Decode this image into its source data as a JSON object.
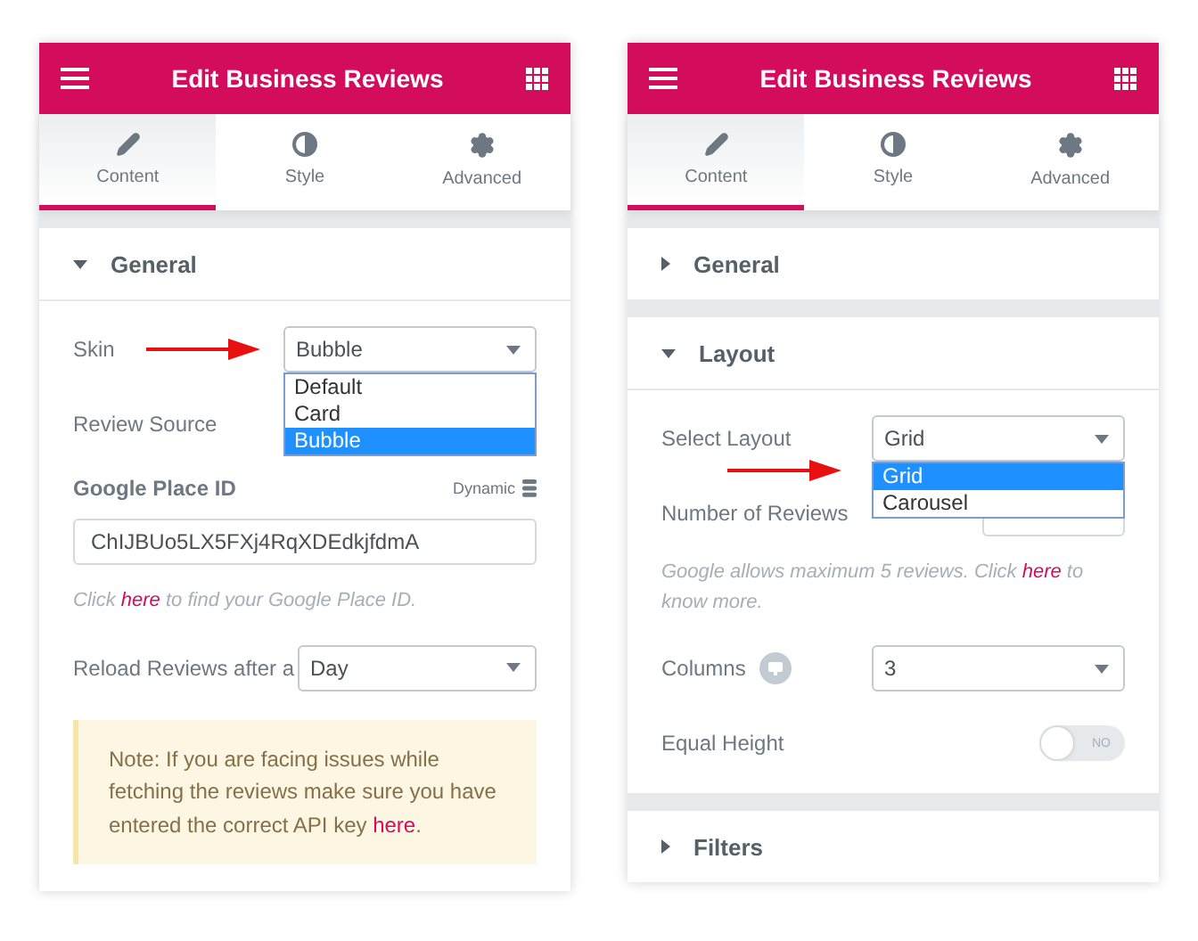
{
  "panels": [
    {
      "title": "Edit Business Reviews",
      "tabs": [
        {
          "label": "Content",
          "selected": true
        },
        {
          "label": "Style",
          "selected": false
        },
        {
          "label": "Advanced",
          "selected": false
        }
      ],
      "sections": [
        {
          "title": "General",
          "expanded": true,
          "controls": [
            {
              "kind": "select",
              "label": "Skin",
              "value": "Bubble",
              "open": true,
              "options": [
                {
                  "label": "Default",
                  "selected": false
                },
                {
                  "label": "Card",
                  "selected": false
                },
                {
                  "label": "Bubble",
                  "selected": true
                }
              ]
            },
            {
              "kind": "label",
              "label": "Review Source"
            },
            {
              "kind": "text",
              "label": "Google Place ID",
              "dynamic": "Dynamic",
              "value": "ChIJBUo5LX5FXj4RqXDEdkjfdmA"
            },
            {
              "kind": "hint",
              "before": "Click ",
              "link": "here",
              "after": " to find your Google Place ID."
            },
            {
              "kind": "select",
              "label": "Reload Reviews after a",
              "value": "Day",
              "open": false,
              "wide": true
            },
            {
              "kind": "note",
              "before": "Note: If you are facing issues while fetching the reviews make sure you have entered the correct API key ",
              "link": "here",
              "after": "."
            }
          ]
        }
      ]
    },
    {
      "title": "Edit Business Reviews",
      "tabs": [
        {
          "label": "Content",
          "selected": true
        },
        {
          "label": "Style",
          "selected": false
        },
        {
          "label": "Advanced",
          "selected": false
        }
      ],
      "sections": [
        {
          "title": "General",
          "expanded": false
        },
        {
          "title": "Layout",
          "expanded": true,
          "controls": [
            {
              "kind": "select",
              "label": "Select Layout",
              "value": "Grid",
              "open": true,
              "options": [
                {
                  "label": "Grid",
                  "selected": true
                },
                {
                  "label": "Carousel",
                  "selected": false
                }
              ]
            },
            {
              "kind": "number",
              "label": "Number of Reviews"
            },
            {
              "kind": "hint",
              "before": "Google allows maximum 5 reviews. Click ",
              "link": "here",
              "after": " to know more."
            },
            {
              "kind": "select",
              "label": "Columns",
              "value": "3",
              "open": false,
              "device_icon": true
            },
            {
              "kind": "toggle",
              "label": "Equal Height",
              "on": false,
              "text": "NO"
            }
          ]
        },
        {
          "title": "Filters",
          "expanded": false
        }
      ]
    }
  ]
}
